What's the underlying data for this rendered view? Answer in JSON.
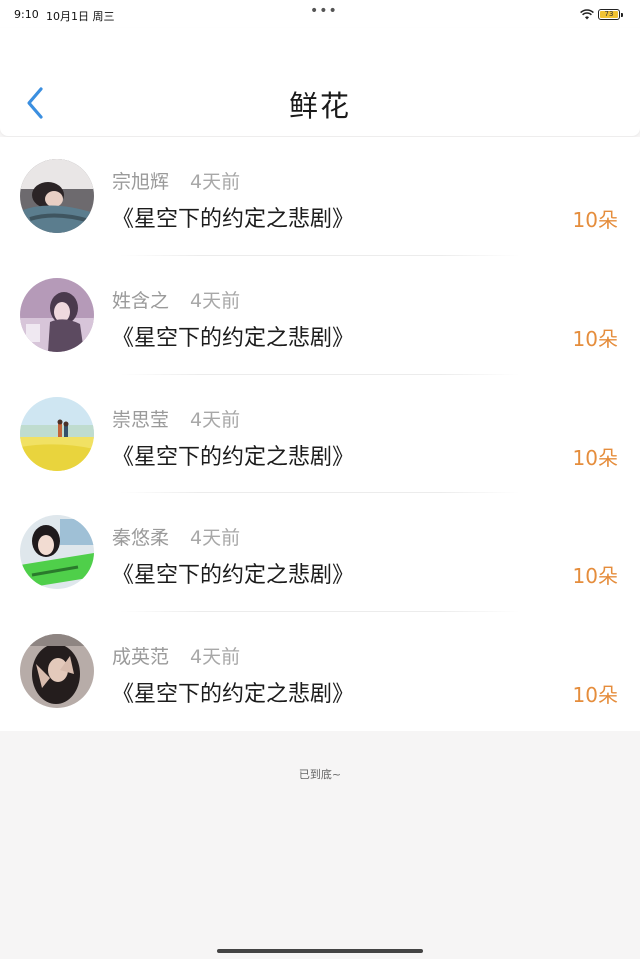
{
  "status_bar": {
    "time": "9:10",
    "date": "10月1日 周三",
    "dots": "•••",
    "battery_level": "73"
  },
  "header": {
    "title": "鲜花",
    "back_icon": "chevron-left-icon",
    "accent_color": "#3b8fe0"
  },
  "records": [
    {
      "name": "宗旭辉",
      "time": "4天前",
      "title": "《星空下的约定之悲剧》",
      "amount": "10朵"
    },
    {
      "name": "姓含之",
      "time": "4天前",
      "title": "《星空下的约定之悲剧》",
      "amount": "10朵"
    },
    {
      "name": "崇思莹",
      "time": "4天前",
      "title": "《星空下的约定之悲剧》",
      "amount": "10朵"
    },
    {
      "name": "秦悠柔",
      "time": "4天前",
      "title": "《星空下的约定之悲剧》",
      "amount": "10朵"
    },
    {
      "name": "成英范",
      "time": "4天前",
      "title": "《星空下的约定之悲剧》",
      "amount": "10朵"
    }
  ],
  "footer": {
    "end_text": "已到底~"
  },
  "colors": {
    "amount": "#e58d3c",
    "name": "#9a9a9a",
    "background": "#f6f5f5"
  }
}
